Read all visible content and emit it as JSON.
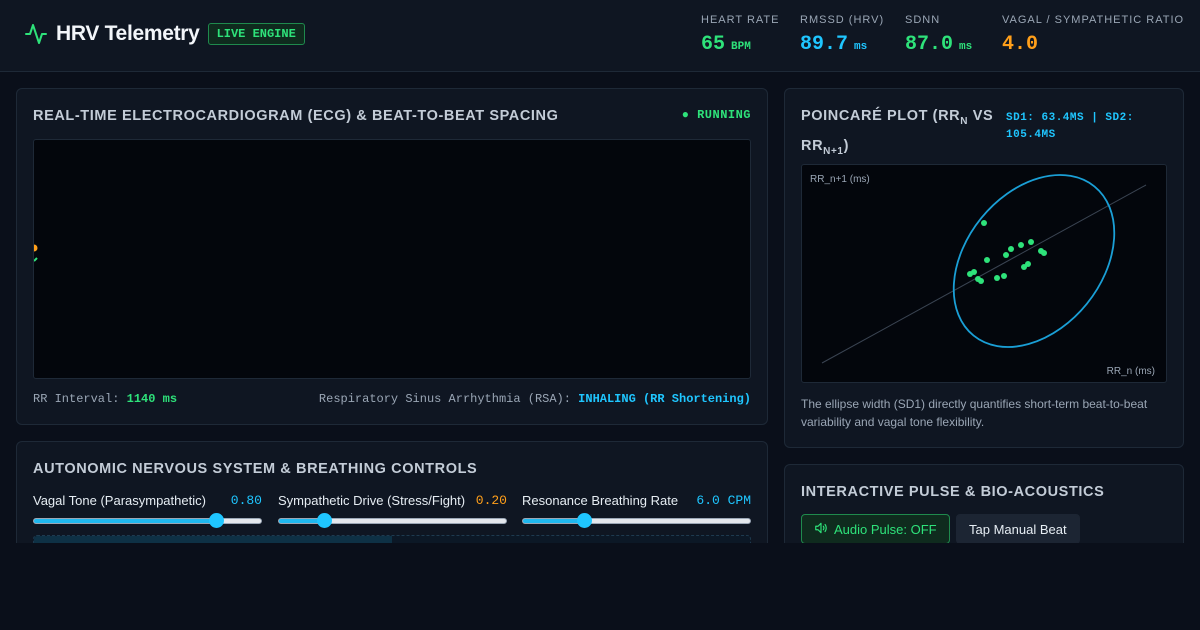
{
  "app": {
    "title": "HRV Telemetry",
    "badge": "LIVE ENGINE"
  },
  "metrics": [
    {
      "label": "HEART RATE",
      "value": "65",
      "unit": "BPM",
      "color": "#2ee27a"
    },
    {
      "label": "RMSSD (HRV)",
      "value": "89.7",
      "unit": "ms",
      "color": "#1fc6ff"
    },
    {
      "label": "SDNN",
      "value": "87.0",
      "unit": "ms",
      "color": "#2ee27a"
    },
    {
      "label": "VAGAL / SYMPATHETIC RATIO",
      "value": "4.0",
      "unit": "",
      "color": "#ff9f1a"
    }
  ],
  "ecg": {
    "title": "REAL-TIME ELECTROCARDIOGRAM (ECG) & BEAT-TO-BEAT SPACING",
    "status": "● RUNNING",
    "rr_label": "RR Interval:",
    "rr_value": "1140 ms",
    "rsa_label": "Respiratory Sinus Arrhythmia (RSA):",
    "rsa_value": "INHALING (RR Shortening)"
  },
  "controls": {
    "title": "AUTONOMIC NERVOUS SYSTEM & BREATHING CONTROLS",
    "sliders": [
      {
        "label": "Vagal Tone (Parasympathetic)",
        "value": "0.80",
        "fraction": 0.8,
        "color": "#1fc6ff"
      },
      {
        "label": "Sympathetic Drive (Stress/Fight)",
        "value": "0.20",
        "fraction": 0.2,
        "color": "#ff9f1a"
      },
      {
        "label": "Resonance Breathing Rate",
        "value": "6.0 CPM",
        "fraction": 0.27,
        "color": "#1fc6ff"
      }
    ],
    "breath_progress": 0.5
  },
  "poincare": {
    "title_main": "POINCARÉ PLOT (RR",
    "title_sub1": "N",
    "title_mid": " VS RR",
    "title_sub2": "N+1",
    "title_end": ")",
    "sd_readout": "SD1: 63.4MS | SD2: 105.4MS",
    "y_axis": "RR_n+1 (ms)",
    "x_axis": "RR_n (ms)",
    "description": "The ellipse width (SD1) directly quantifies short-term beat-to-beat variability and vagal tone flexibility."
  },
  "audio": {
    "title": "INTERACTIVE PULSE & BIO-ACOUSTICS",
    "pulse_button": "Audio Pulse: OFF",
    "tap_button": "Tap Manual Beat"
  }
}
